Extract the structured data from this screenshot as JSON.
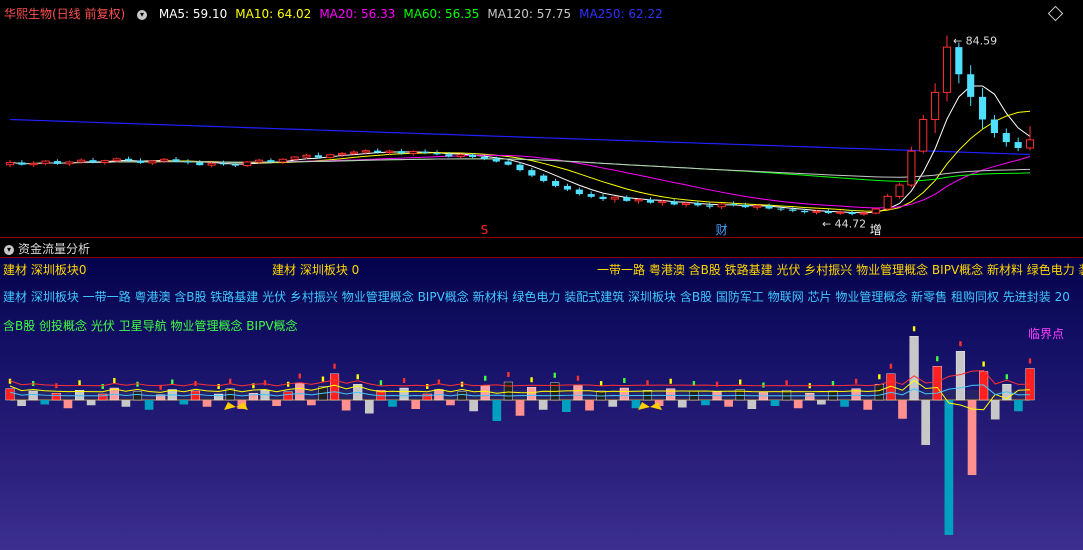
{
  "legend": {
    "stock_name": "华熙生物(日线 前复权)",
    "ma_items": [
      {
        "label": "MA5: 59.10",
        "color": "#ffffff"
      },
      {
        "label": "MA10: 64.02",
        "color": "#ffff00"
      },
      {
        "label": "MA20: 56.33",
        "color": "#ff00ff"
      },
      {
        "label": "MA60: 56.35",
        "color": "#00ff00"
      },
      {
        "label": "MA120: 57.75",
        "color": "#c8c8c8"
      },
      {
        "label": "MA250: 62.22",
        "color": "#3030ff"
      }
    ]
  },
  "price_pane": {
    "high_label": "84.59",
    "low_label": "44.72",
    "markers": [
      {
        "text": "S",
        "index": 40,
        "color": "#ff2020"
      },
      {
        "text": "财",
        "index": 60,
        "color": "#40a0ff"
      },
      {
        "text": "增",
        "index": 73,
        "color": "#ffffff"
      }
    ]
  },
  "flow_pane": {
    "title": "资金流量分析",
    "line1_left": "建材 深圳板块0",
    "line1_mid": "建材 深圳板块 0",
    "line1_right": "一带一路 粤港澳 含B股 铁路基建 光伏 乡村振兴 物业管理概念 BIPV概念 新材料 绿色电力 装",
    "line2": "建材 深圳板块 一带一路 粤港澳 含B股 铁路基建 光伏 乡村振兴 物业管理概念 BIPV概念 新材料 绿色电力 装配式建筑 深圳板块 含B股 国防军工 物联网 芯片 物业管理概念 新零售 租购同权 先进封装 20",
    "line3": "含B股 创投概念 光伏 卫星导航 物业管理概念 BIPV概念",
    "critical_label": "临界点"
  },
  "chart_data": {
    "type": "candlestick",
    "title": "华熙生物(日线 前复权)",
    "indicators": [
      "MA5",
      "MA10",
      "MA20",
      "MA60",
      "MA120",
      "MA250"
    ],
    "ohlc": [
      [
        56,
        57,
        55.5,
        56.5
      ],
      [
        56.5,
        57,
        55.8,
        56
      ],
      [
        56,
        56.8,
        55.5,
        56.3
      ],
      [
        56.3,
        57,
        55.9,
        56.8
      ],
      [
        56.8,
        57.2,
        56,
        56.2
      ],
      [
        56.2,
        56.9,
        55.7,
        56.6
      ],
      [
        56.6,
        57.4,
        56.2,
        57
      ],
      [
        57,
        57.5,
        56.3,
        56.5
      ],
      [
        56.5,
        57.1,
        56,
        56.9
      ],
      [
        56.9,
        57.6,
        56.5,
        57.3
      ],
      [
        57.3,
        57.8,
        56.6,
        56.9
      ],
      [
        56.9,
        57.4,
        56.2,
        56.4
      ],
      [
        56.4,
        57,
        55.9,
        56.8
      ],
      [
        56.8,
        57.5,
        56.4,
        57.2
      ],
      [
        57.2,
        57.7,
        56.5,
        56.7
      ],
      [
        56.7,
        57.2,
        56.1,
        56.5
      ],
      [
        56.5,
        57,
        55.8,
        55.9
      ],
      [
        55.9,
        56.6,
        55.4,
        56.3
      ],
      [
        56.3,
        56.9,
        55.8,
        56.1
      ],
      [
        56.1,
        56.6,
        55.5,
        55.8
      ],
      [
        55.8,
        56.8,
        55.5,
        56.6
      ],
      [
        56.6,
        57.3,
        56.2,
        57
      ],
      [
        57,
        57.4,
        56.3,
        56.6
      ],
      [
        56.6,
        57.4,
        56.2,
        57.2
      ],
      [
        57.2,
        57.9,
        56.8,
        57.7
      ],
      [
        57.7,
        58.4,
        57.2,
        58.1
      ],
      [
        58.1,
        58.7,
        57.4,
        57.6
      ],
      [
        57.6,
        58.4,
        57.3,
        58.2
      ],
      [
        58.2,
        58.8,
        57.7,
        58.5
      ],
      [
        58.5,
        59.2,
        58,
        58.8
      ],
      [
        58.8,
        59.4,
        58.3,
        59.1
      ],
      [
        59.1,
        59.6,
        58.4,
        58.7
      ],
      [
        58.7,
        59.3,
        58.2,
        59
      ],
      [
        59,
        59.5,
        58.2,
        58.5
      ],
      [
        58.5,
        59.2,
        58,
        58.9
      ],
      [
        58.9,
        59.4,
        58.3,
        58.6
      ],
      [
        58.6,
        59.2,
        58.1,
        58.3
      ],
      [
        58.3,
        58.8,
        57.6,
        57.8
      ],
      [
        57.8,
        58.5,
        57.3,
        58.2
      ],
      [
        58.2,
        58.6,
        57.5,
        57.7
      ],
      [
        57.7,
        58.2,
        57,
        57.3
      ],
      [
        57.3,
        57.8,
        56.5,
        56.7
      ],
      [
        56.7,
        57.2,
        55.8,
        56
      ],
      [
        56,
        56.5,
        54.5,
        54.8
      ],
      [
        54.8,
        55.3,
        53.3,
        53.6
      ],
      [
        53.6,
        54,
        52.1,
        52.4
      ],
      [
        52.4,
        52.9,
        51,
        51.3
      ],
      [
        51.3,
        51.8,
        50.2,
        50.5
      ],
      [
        50.5,
        51,
        49.2,
        49.5
      ],
      [
        49.5,
        50.1,
        48.6,
        48.9
      ],
      [
        48.9,
        49.5,
        48,
        48.4
      ],
      [
        48.4,
        49,
        47.6,
        48.8
      ],
      [
        48.8,
        49.2,
        47.8,
        48
      ],
      [
        48,
        48.6,
        47.4,
        48.3
      ],
      [
        48.3,
        48.8,
        47.4,
        47.6
      ],
      [
        47.6,
        48.2,
        46.9,
        47.9
      ],
      [
        47.9,
        48.4,
        47,
        47.2
      ],
      [
        47.2,
        47.8,
        46.6,
        47.5
      ],
      [
        47.5,
        48,
        46.7,
        47
      ],
      [
        47,
        47.6,
        46.3,
        46.7
      ],
      [
        46.7,
        47.5,
        46.2,
        47.3
      ],
      [
        47.3,
        47.9,
        46.8,
        47.1
      ],
      [
        47.1,
        47.6,
        46.4,
        46.6
      ],
      [
        46.6,
        47.2,
        46,
        46.9
      ],
      [
        46.9,
        47.4,
        46.1,
        46.3
      ],
      [
        46.3,
        46.8,
        45.7,
        46.1
      ],
      [
        46.1,
        46.6,
        45.5,
        45.8
      ],
      [
        45.8,
        46.3,
        45.2,
        45.5
      ],
      [
        45.5,
        46,
        45,
        45.7
      ],
      [
        45.7,
        46.2,
        45.1,
        45.3
      ],
      [
        45.3,
        45.9,
        44.9,
        45.5
      ],
      [
        45.5,
        46,
        44.8,
        45.1
      ],
      [
        45.1,
        45.6,
        44.72,
        45.3
      ],
      [
        45.3,
        46.5,
        45,
        46.2
      ],
      [
        46.2,
        49.5,
        46,
        49
      ],
      [
        49,
        52,
        48.5,
        51.5
      ],
      [
        51.5,
        60,
        51,
        59
      ],
      [
        59,
        67,
        58.5,
        66
      ],
      [
        66,
        74,
        63,
        72
      ],
      [
        72,
        84.59,
        70,
        82
      ],
      [
        82,
        83,
        74,
        76
      ],
      [
        76,
        78,
        69,
        71
      ],
      [
        71,
        73,
        64,
        66
      ],
      [
        66,
        67,
        62,
        63
      ],
      [
        63,
        64,
        60,
        61
      ],
      [
        61,
        62,
        59,
        59.7
      ],
      [
        59.7,
        64.5,
        59.2,
        61.5
      ]
    ],
    "ma_values": {
      "MA5": 59.1,
      "MA10": 64.02,
      "MA20": 56.33,
      "MA60": 56.35,
      "MA120": 57.75,
      "MA250": 62.22
    },
    "annotations": [
      {
        "text": "84.59",
        "type": "high"
      },
      {
        "text": "44.72",
        "type": "low"
      },
      {
        "text": "S"
      },
      {
        "text": "财"
      },
      {
        "text": "增"
      }
    ],
    "flow_values": [
      1.5,
      -0.8,
      1.2,
      -0.6,
      0.9,
      -1.1,
      1.3,
      -0.7,
      0.8,
      1.6,
      -0.9,
      1.1,
      -1.3,
      0.7,
      1.4,
      -0.6,
      1.2,
      -0.9,
      0.8,
      1.5,
      -1.2,
      0.9,
      1.3,
      -0.8,
      1.1,
      2.2,
      -0.7,
      1.8,
      3.5,
      -1.4,
      2.1,
      -1.8,
      1.3,
      -0.9,
      1.6,
      -1.2,
      0.8,
      1.4,
      -0.7,
      1.1,
      -1.5,
      1.9,
      -2.8,
      2.4,
      -2.1,
      1.7,
      -1.3,
      2.3,
      -1.6,
      1.9,
      -1.4,
      1.2,
      -0.9,
      1.6,
      -1.1,
      1.3,
      -0.8,
      1.5,
      -1,
      1.2,
      -0.7,
      1.1,
      -0.9,
      1.4,
      -1.2,
      1,
      -0.8,
      1.3,
      -1.1,
      0.9,
      -0.6,
      1.2,
      -0.9,
      1.5,
      -1.3,
      2.1,
      3.5,
      -2.5,
      8.5,
      -6,
      4.5,
      -18,
      6.5,
      -10,
      3.8,
      -2.6,
      2.1,
      -1.5,
      4.2
    ]
  }
}
